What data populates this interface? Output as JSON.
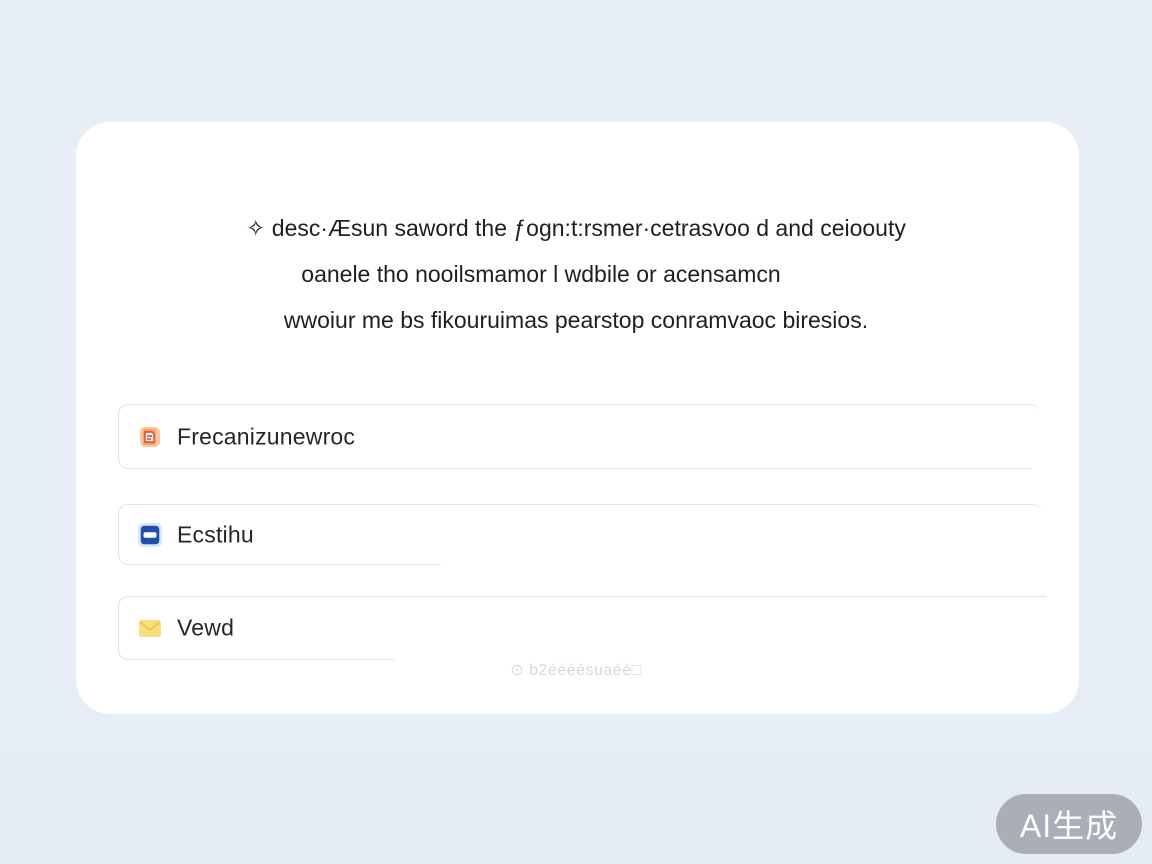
{
  "description": {
    "lines": [
      "✧ desc·Æsun saword the ƒogn:t:rsmer·cetrasvoo d and ceioouty",
      "oanele tho nooilsmamor l wdbile or acensamcn",
      "wwoiur me bs fikouruimas pearstop conramvaoc biresios."
    ]
  },
  "options": [
    {
      "label": "Frecanizunewroc",
      "icon": "document-icon",
      "icon_color": "#e8742a"
    },
    {
      "label": "Ecstihu",
      "icon": "card-icon",
      "icon_color": "#1f4fa8"
    },
    {
      "label": "Vewd",
      "icon": "envelope-icon",
      "icon_color": "#f5d56b"
    }
  ],
  "footnote": "⊙ b2éééésuaéé□",
  "badge": {
    "label": "AI生成"
  },
  "colors": {
    "background": "#e8eef6",
    "card": "#ffffff",
    "border": "#dfe3e8",
    "text": "#1f1f1f",
    "badge": "#9a9ea4"
  }
}
